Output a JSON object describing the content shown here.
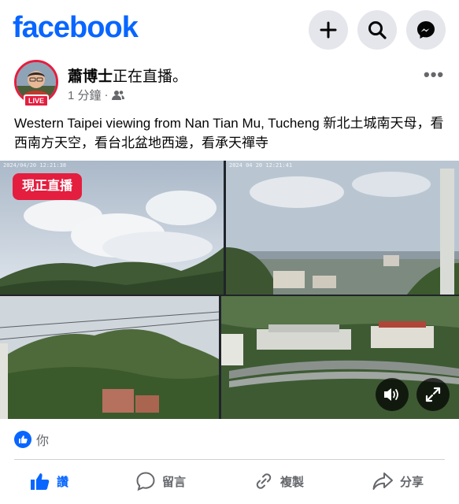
{
  "app": {
    "logo_text": "facebook",
    "brand_color": "#0866ff",
    "live_color": "#e41e3f"
  },
  "top_actions": [
    {
      "icon": "plus-icon"
    },
    {
      "icon": "search-icon"
    },
    {
      "icon": "messenger-icon"
    }
  ],
  "post": {
    "author": "蕭博士",
    "status": "正在直播。",
    "avatar_badge": "LIVE",
    "time": "1 分鐘",
    "separator": "·",
    "audience_icon": "friends-icon",
    "more_label": "•••",
    "text": "Western Taipei viewing from Nan Tian Mu, Tucheng 新北土城南天母，看西南方天空，看台北盆地西邊，看承天禪寺"
  },
  "media": {
    "live_label": "現正直播",
    "cams": [
      {
        "stamp": "2024/04/20 12:21:38"
      },
      {
        "stamp": "2024 04 20 12:21:41"
      },
      {
        "stamp": ""
      },
      {
        "stamp": ""
      }
    ],
    "controls": [
      {
        "icon": "speaker-icon"
      },
      {
        "icon": "fullscreen-icon"
      }
    ]
  },
  "reactions": {
    "icon": "like-icon",
    "text": "你"
  },
  "actions": {
    "like": "讚",
    "comment": "留言",
    "copy": "複製",
    "share": "分享"
  }
}
